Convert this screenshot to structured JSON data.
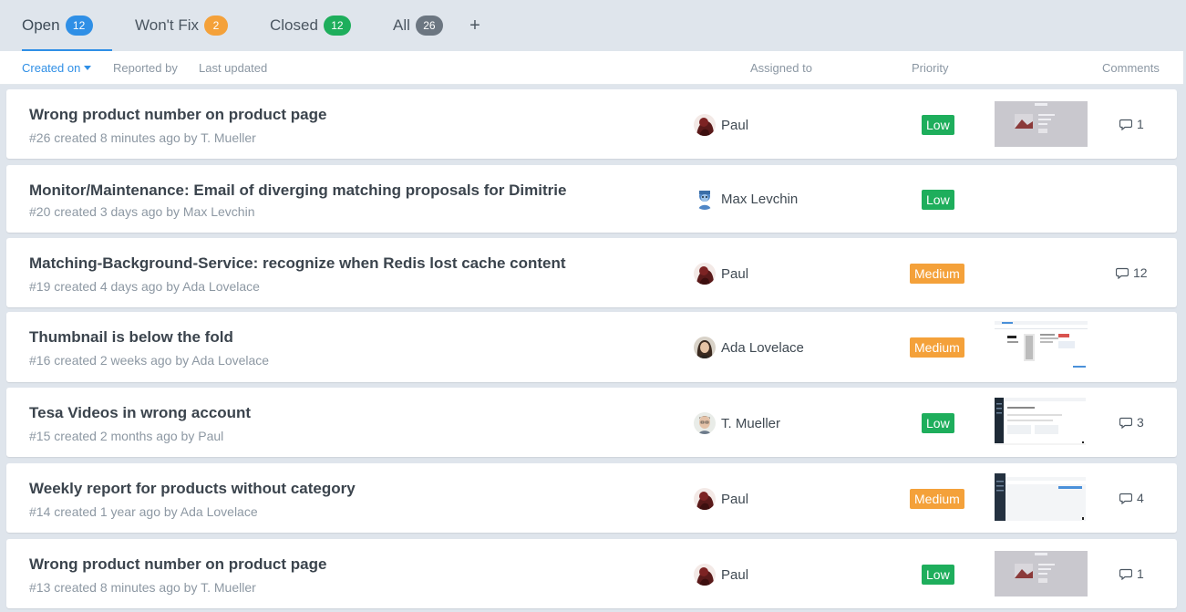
{
  "tabs": [
    {
      "label": "Open",
      "count": "12",
      "color": "#2f8fe6"
    },
    {
      "label": "Won't Fix",
      "count": "2",
      "color": "#f4a13a"
    },
    {
      "label": "Closed",
      "count": "12",
      "color": "#1eae5c"
    },
    {
      "label": "All",
      "count": "26",
      "color": "#6c7681"
    }
  ],
  "tab_add_label": "+",
  "columns": {
    "created_on": "Created on",
    "reported_by": "Reported by",
    "last_updated": "Last updated",
    "assigned_to": "Assigned to",
    "priority": "Priority",
    "comments": "Comments"
  },
  "priority_colors": {
    "Low": "#1eae5c",
    "Medium": "#f4a13a"
  },
  "issues": [
    {
      "title": "Wrong product number on product page",
      "meta": "#26 created 8 minutes ago by T. Mueller",
      "assignee": "Paul",
      "avatar": "paul",
      "priority": "Low",
      "thumbnail": "grey-shot",
      "comments": "1"
    },
    {
      "title": "Monitor/Maintenance: Email of diverging matching proposals for Dimitrie",
      "meta": "#20 created 3 days ago by Max Levchin",
      "assignee": "Max Levchin",
      "avatar": "max",
      "priority": "Low",
      "thumbnail": "",
      "comments": ""
    },
    {
      "title": "Matching-Background-Service: recognize when Redis lost cache content",
      "meta": "#19 created 4 days ago by Ada Lovelace",
      "assignee": "Paul",
      "avatar": "paul",
      "priority": "Medium",
      "thumbnail": "",
      "comments": "12"
    },
    {
      "title": "Thumbnail is below the fold",
      "meta": "#16 created 2 weeks ago by Ada Lovelace",
      "assignee": "Ada Lovelace",
      "avatar": "ada",
      "priority": "Medium",
      "thumbnail": "white-shot",
      "comments": ""
    },
    {
      "title": "Tesa Videos in wrong account",
      "meta": "#15 created 2 months ago by Paul",
      "assignee": "T. Mueller",
      "avatar": "tmueller",
      "priority": "Low",
      "thumbnail": "dark-side-shot",
      "comments": "3"
    },
    {
      "title": "Weekly report for products without category",
      "meta": "#14 created 1 year ago by Ada Lovelace",
      "assignee": "Paul",
      "avatar": "paul",
      "priority": "Medium",
      "thumbnail": "dark-side-shot-2",
      "comments": "4"
    },
    {
      "title": "Wrong product number on product page",
      "meta": "#13 created 8 minutes ago by T. Mueller",
      "assignee": "Paul",
      "avatar": "paul",
      "priority": "Low",
      "thumbnail": "grey-shot",
      "comments": "1"
    }
  ]
}
